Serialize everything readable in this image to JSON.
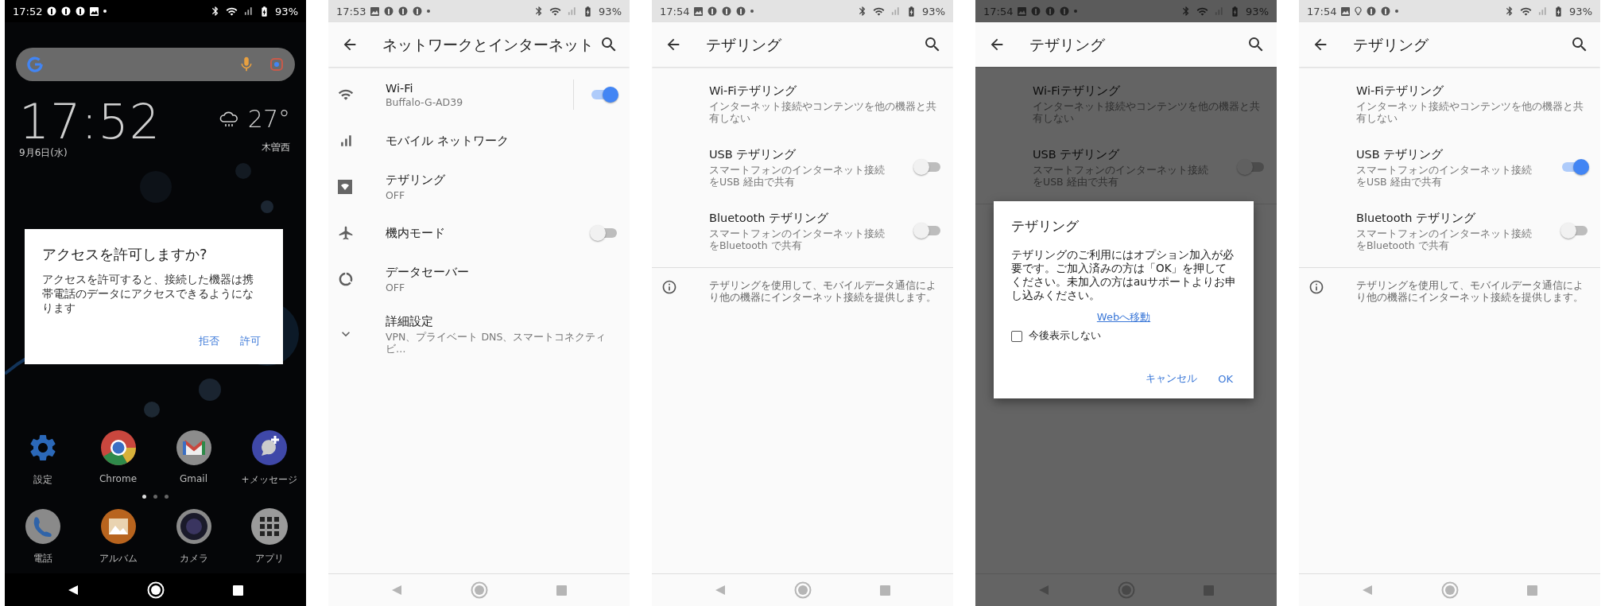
{
  "screens": [
    {
      "kind": "home",
      "status_bar": {
        "time": "17:52",
        "battery": "93%"
      },
      "clock": {
        "time": "17:52",
        "date": "9月6日(水)"
      },
      "weather": {
        "temperature": "27°",
        "location": "木曽西"
      },
      "dialog": {
        "title": "アクセスを許可しますか?",
        "message": "アクセスを許可すると、接続した機器は携帯電話のデータにアクセスできるようになります",
        "buttons": [
          "拒否",
          "許可"
        ]
      },
      "apps": [
        {
          "label": "設定"
        },
        {
          "label": "Chrome"
        },
        {
          "label": "Gmail"
        },
        {
          "label": "+メッセージ"
        }
      ],
      "page_dots": [
        {
          "selected": true
        },
        {
          "selected": false
        },
        {
          "selected": false
        }
      ],
      "dock": [
        {
          "label": "電話"
        },
        {
          "label": "アルバム"
        },
        {
          "label": "カメラ"
        },
        {
          "label": "アプリ"
        }
      ]
    },
    {
      "kind": "settings",
      "status_bar": {
        "time": "17:53",
        "battery": "93%"
      },
      "title": "ネットワークとインターネット",
      "items": [
        {
          "kind": "split_toggle",
          "title": "Wi-Fi",
          "summary": "Buffalo-G-AD39",
          "on": true
        },
        {
          "kind": "plain",
          "title": "モバイル ネットワーク"
        },
        {
          "kind": "plain",
          "title": "テザリング",
          "summary": "OFF"
        },
        {
          "kind": "toggle",
          "title": "機内モード",
          "on": false
        },
        {
          "kind": "plain",
          "title": "データセーバー",
          "summary": "OFF"
        },
        {
          "kind": "plain",
          "title": "詳細設定",
          "summary": "VPN、プライベート DNS、スマートコネクティビ…"
        }
      ]
    },
    {
      "kind": "settings",
      "status_bar": {
        "time": "17:54",
        "battery": "93%"
      },
      "title": "テザリング",
      "items": [
        {
          "kind": "plain",
          "title": "Wi-Fiテザリング",
          "summary": "インターネット接続やコンテンツを他の機器と共有しない"
        },
        {
          "kind": "toggle",
          "title": "USB テザリング",
          "summary": "スマートフォンのインターネット接続をUSB 経由で共有",
          "on": false
        },
        {
          "kind": "toggle",
          "title": "Bluetooth テザリング",
          "summary": "スマートフォンのインターネット接続をBluetooth で共有",
          "on": false
        }
      ],
      "footer": "テザリングを使用して、モバイルデータ通信により他の機器にインターネット接続を提供します。"
    },
    {
      "kind": "settings",
      "status_bar": {
        "time": "17:54",
        "battery": "93%"
      },
      "title": "テザリング",
      "items": [
        {
          "kind": "plain",
          "title": "Wi-Fiテザリング",
          "summary": "インターネット接続やコンテンツを他の機器と共有しない"
        },
        {
          "kind": "toggle",
          "title": "USB テザリング",
          "summary": "スマートフォンのインターネット接続をUSB 経由で共有",
          "on": false
        }
      ],
      "dialog": {
        "title": "テザリング",
        "message": "テザリングのご利用にはオプション加入が必要です。ご加入済みの方は「OK」を押してください。未加入の方はauサポートよりお申し込みください。",
        "link": "Webへ移動",
        "checkbox": {
          "label": "今後表示しない",
          "checked": false
        },
        "buttons": [
          "キャンセル",
          "OK"
        ]
      }
    },
    {
      "kind": "settings",
      "status_bar": {
        "time": "17:54",
        "battery": "93%"
      },
      "title": "テザリング",
      "items": [
        {
          "kind": "plain",
          "title": "Wi-Fiテザリング",
          "summary": "インターネット接続やコンテンツを他の機器と共有しない"
        },
        {
          "kind": "toggle",
          "title": "USB テザリング",
          "summary": "スマートフォンのインターネット接続をUSB 経由で共有",
          "on": true
        },
        {
          "kind": "toggle",
          "title": "Bluetooth テザリング",
          "summary": "スマートフォンのインターネット接続をBluetooth で共有",
          "on": false
        }
      ],
      "footer": "テザリングを使用して、モバイルデータ通信により他の機器にインターネット接続を提供します。"
    }
  ]
}
